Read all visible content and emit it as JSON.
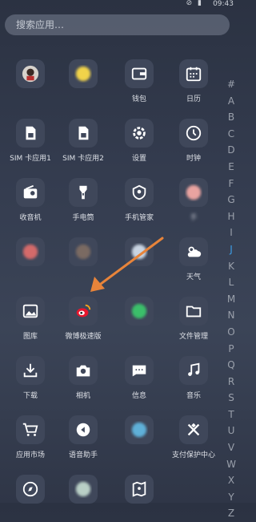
{
  "status_bar": {
    "time": "09:43",
    "icons": "⊘ ▮"
  },
  "search": {
    "placeholder": "搜索应用…"
  },
  "top_row_labels": [
    "",
    "",
    "",
    ""
  ],
  "apps": [
    {
      "label": "",
      "icon": "avatar-icon",
      "blurred": true
    },
    {
      "label": "",
      "icon": "blurred-app-icon",
      "blurred": true
    },
    {
      "label": "钱包",
      "icon": "wallet-icon"
    },
    {
      "label": "日历",
      "icon": "calendar-icon"
    },
    {
      "label": "SIM 卡应用1",
      "icon": "sim-card-icon"
    },
    {
      "label": "SIM 卡应用2",
      "icon": "sim-card-icon"
    },
    {
      "label": "设置",
      "icon": "gear-icon"
    },
    {
      "label": "时钟",
      "icon": "clock-icon"
    },
    {
      "label": "收音机",
      "icon": "radio-icon"
    },
    {
      "label": "手电筒",
      "icon": "flashlight-icon"
    },
    {
      "label": "手机管家",
      "icon": "phone-manager-icon"
    },
    {
      "label": "手",
      "icon": "blurred-app-icon",
      "blurred": true
    },
    {
      "label": "",
      "icon": "blurred-app-icon",
      "blurred": true
    },
    {
      "label": "",
      "icon": "blurred-app-icon",
      "blurred": true
    },
    {
      "label": "",
      "icon": "blurred-app-icon",
      "blurred": true
    },
    {
      "label": "天气",
      "icon": "weather-icon"
    },
    {
      "label": "图库",
      "icon": "gallery-icon"
    },
    {
      "label": "微博极速版",
      "icon": "weibo-icon"
    },
    {
      "label": "",
      "icon": "blurred-app-icon",
      "blurred": true
    },
    {
      "label": "文件管理",
      "icon": "folder-icon"
    },
    {
      "label": "下载",
      "icon": "download-icon"
    },
    {
      "label": "相机",
      "icon": "camera-icon"
    },
    {
      "label": "信息",
      "icon": "message-icon"
    },
    {
      "label": "音乐",
      "icon": "music-icon"
    },
    {
      "label": "应用市场",
      "icon": "shopping-cart-icon"
    },
    {
      "label": "语音助手",
      "icon": "voice-assistant-icon"
    },
    {
      "label": "",
      "icon": "blurred-app-icon",
      "blurred": true
    },
    {
      "label": "支付保护中心",
      "icon": "payment-protection-icon"
    },
    {
      "label": "",
      "icon": "compass-icon"
    },
    {
      "label": "",
      "icon": "blurred-app-icon",
      "blurred": true
    },
    {
      "label": "",
      "icon": "map-icon"
    }
  ],
  "index_letters": [
    "#",
    "A",
    "B",
    "C",
    "D",
    "E",
    "F",
    "G",
    "H",
    "I",
    "J",
    "K",
    "L",
    "M",
    "N",
    "O",
    "P",
    "Q",
    "R",
    "S",
    "T",
    "U",
    "V",
    "W",
    "X",
    "Y",
    "Z"
  ],
  "active_letter": "J",
  "colors": {
    "accent": "#3d9ee8",
    "arrow": "#e8843a"
  }
}
